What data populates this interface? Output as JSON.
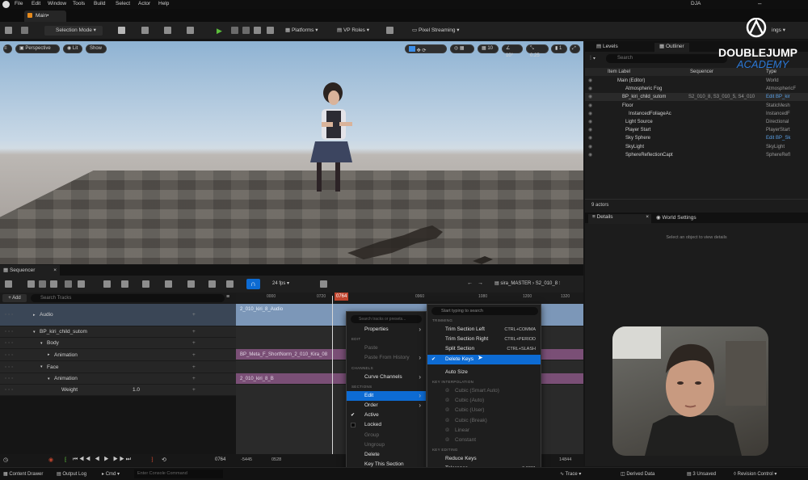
{
  "menubar": {
    "items": [
      "File",
      "Edit",
      "Window",
      "Tools",
      "Build",
      "Select",
      "Actor",
      "Help"
    ],
    "user": "DJA"
  },
  "tab": {
    "label": "Main•"
  },
  "toolbar": {
    "selection_mode": "Selection Mode",
    "platforms": "Platforms",
    "vp_roles": "VP Roles",
    "pixel_streaming": "Pixel Streaming",
    "settings": "ings"
  },
  "viewport": {
    "perspective": "Perspective",
    "lit": "Lit",
    "show": "Show",
    "angle": "10°",
    "speed": "0.25",
    "cam": "1",
    "grid": "10"
  },
  "watermark": {
    "line1": "DOUBLEJUMP",
    "line2": "ACADEMY"
  },
  "outliner": {
    "tab_levels": "Levels",
    "tab_outliner": "Outliner",
    "search_placeholder": "Search",
    "col_label": "Item Label",
    "col_seq": "Sequencer",
    "col_type": "Type",
    "rows": [
      {
        "label": "Main (Editor)",
        "seq": "",
        "type": "World"
      },
      {
        "label": "Atmospheric Fog",
        "seq": "",
        "type": "AtmosphericF"
      },
      {
        "label": "BP_kiri_child_sutom",
        "seq": "S2_010_8, S3_010_5, S4_010",
        "type": "Edit BP_kir"
      },
      {
        "label": "Floor",
        "seq": "",
        "type": "StaticMesh"
      },
      {
        "label": "InstancedFoliageAc",
        "seq": "",
        "type": "InstancedF"
      },
      {
        "label": "Light Source",
        "seq": "",
        "type": "Directional"
      },
      {
        "label": "Player Start",
        "seq": "",
        "type": "PlayerStart"
      },
      {
        "label": "Sky Sphere",
        "seq": "",
        "type": "Edit BP_Sk"
      },
      {
        "label": "SkyLight",
        "seq": "",
        "type": "SkyLight"
      },
      {
        "label": "SphereReflectionCapt",
        "seq": "",
        "type": "SphereRefl"
      }
    ],
    "actors": "9 actors"
  },
  "details": {
    "tab_details": "Details",
    "tab_world": "World Settings",
    "empty": "Select an object to view details"
  },
  "sequencer": {
    "tab": "Sequencer",
    "fps": "24 fps",
    "breadcrumb1": "sira_MASTER",
    "breadcrumb2": "S2_010_8",
    "add": "+ Add",
    "search_placeholder": "Search Tracks",
    "frame": "0764",
    "left_frame": "-5445",
    "mid_frame": "0528",
    "right_frame": "14844",
    "ruler": [
      "0000",
      "0720",
      "0960",
      "1080",
      "1200",
      "1320"
    ],
    "tracks": [
      {
        "label": "Audio",
        "indent": 1
      },
      {
        "label": "BP_kiri_child_sutom",
        "indent": 1
      },
      {
        "label": "Body",
        "indent": 2
      },
      {
        "label": "Animation",
        "indent": 3
      },
      {
        "label": "Face",
        "indent": 2
      },
      {
        "label": "Animation",
        "indent": 3
      },
      {
        "label": "Weight",
        "indent": 4,
        "value": "1.0"
      }
    ],
    "sections": {
      "audio": "2_010_kiri_8_Audio",
      "body": "BP_Meta_F_ShortNorm_2_010_Kira_08",
      "face": "2_010_kiri_8_B"
    }
  },
  "menu1": {
    "search_placeholder": "Search tracks or presets...",
    "items": [
      {
        "type": "item",
        "label": "Properties",
        "sub": true
      },
      {
        "type": "head",
        "label": "EDIT"
      },
      {
        "type": "item",
        "label": "Paste",
        "disabled": true
      },
      {
        "type": "item",
        "label": "Paste From History",
        "disabled": true,
        "sub": true
      },
      {
        "type": "head",
        "label": "CHANNELS"
      },
      {
        "type": "item",
        "label": "Curve Channels",
        "sub": true
      },
      {
        "type": "head",
        "label": "SECTIONS"
      },
      {
        "type": "item",
        "label": "Edit",
        "sub": true,
        "selected": true
      },
      {
        "type": "item",
        "label": "Order",
        "sub": true
      },
      {
        "type": "item",
        "label": "Active",
        "check": "checked"
      },
      {
        "type": "item",
        "label": "Locked",
        "check": "box"
      },
      {
        "type": "item",
        "label": "Group",
        "disabled": true
      },
      {
        "type": "item",
        "label": "Ungroup",
        "disabled": true
      },
      {
        "type": "item",
        "label": "Delete"
      },
      {
        "type": "item",
        "label": "Key This Section"
      }
    ]
  },
  "menu2": {
    "search_placeholder": "Start typing to search",
    "items": [
      {
        "type": "head",
        "label": "TRIMMING"
      },
      {
        "type": "item",
        "label": "Trim Section Left",
        "shortcut": "CTRL+COMMA"
      },
      {
        "type": "item",
        "label": "Trim Section Right",
        "shortcut": "CTRL+PERIOD"
      },
      {
        "type": "item",
        "label": "Split Section",
        "shortcut": "CTRL+SLASH"
      },
      {
        "type": "item",
        "label": "Delete Keys",
        "check": "checked",
        "selected": true
      },
      {
        "type": "gap"
      },
      {
        "type": "item",
        "label": "Auto Size"
      },
      {
        "type": "head",
        "label": "KEY INTERPOLATION"
      },
      {
        "type": "item",
        "label": "Cubic (Smart Auto)",
        "disabled": true,
        "radio": true
      },
      {
        "type": "item",
        "label": "Cubic (Auto)",
        "disabled": true,
        "radio": true
      },
      {
        "type": "item",
        "label": "Cubic (User)",
        "disabled": true,
        "radio": true
      },
      {
        "type": "item",
        "label": "Cubic (Break)",
        "disabled": true,
        "radio": true
      },
      {
        "type": "item",
        "label": "Linear",
        "disabled": true,
        "radio": true
      },
      {
        "type": "item",
        "label": "Constant",
        "disabled": true,
        "radio": true
      },
      {
        "type": "head",
        "label": "KEY EDITING"
      },
      {
        "type": "item",
        "label": "Reduce Keys"
      },
      {
        "type": "item",
        "label": "Tolerance",
        "shortcut": "0.0001"
      }
    ]
  },
  "status": {
    "content_drawer": "Content Drawer",
    "output_log": "Output Log",
    "cmd": "Cmd",
    "console_placeholder": "Enter Console Command",
    "trace": "Trace",
    "derived": "Derived Data",
    "unsaved": "3 Unsaved",
    "revision": "Revision Control"
  },
  "colors": {
    "accent": "#0d6bd3",
    "audio_section": "#7c97b8",
    "anim_section": "#7a4f76",
    "icon_play": "#5cbf3c"
  }
}
